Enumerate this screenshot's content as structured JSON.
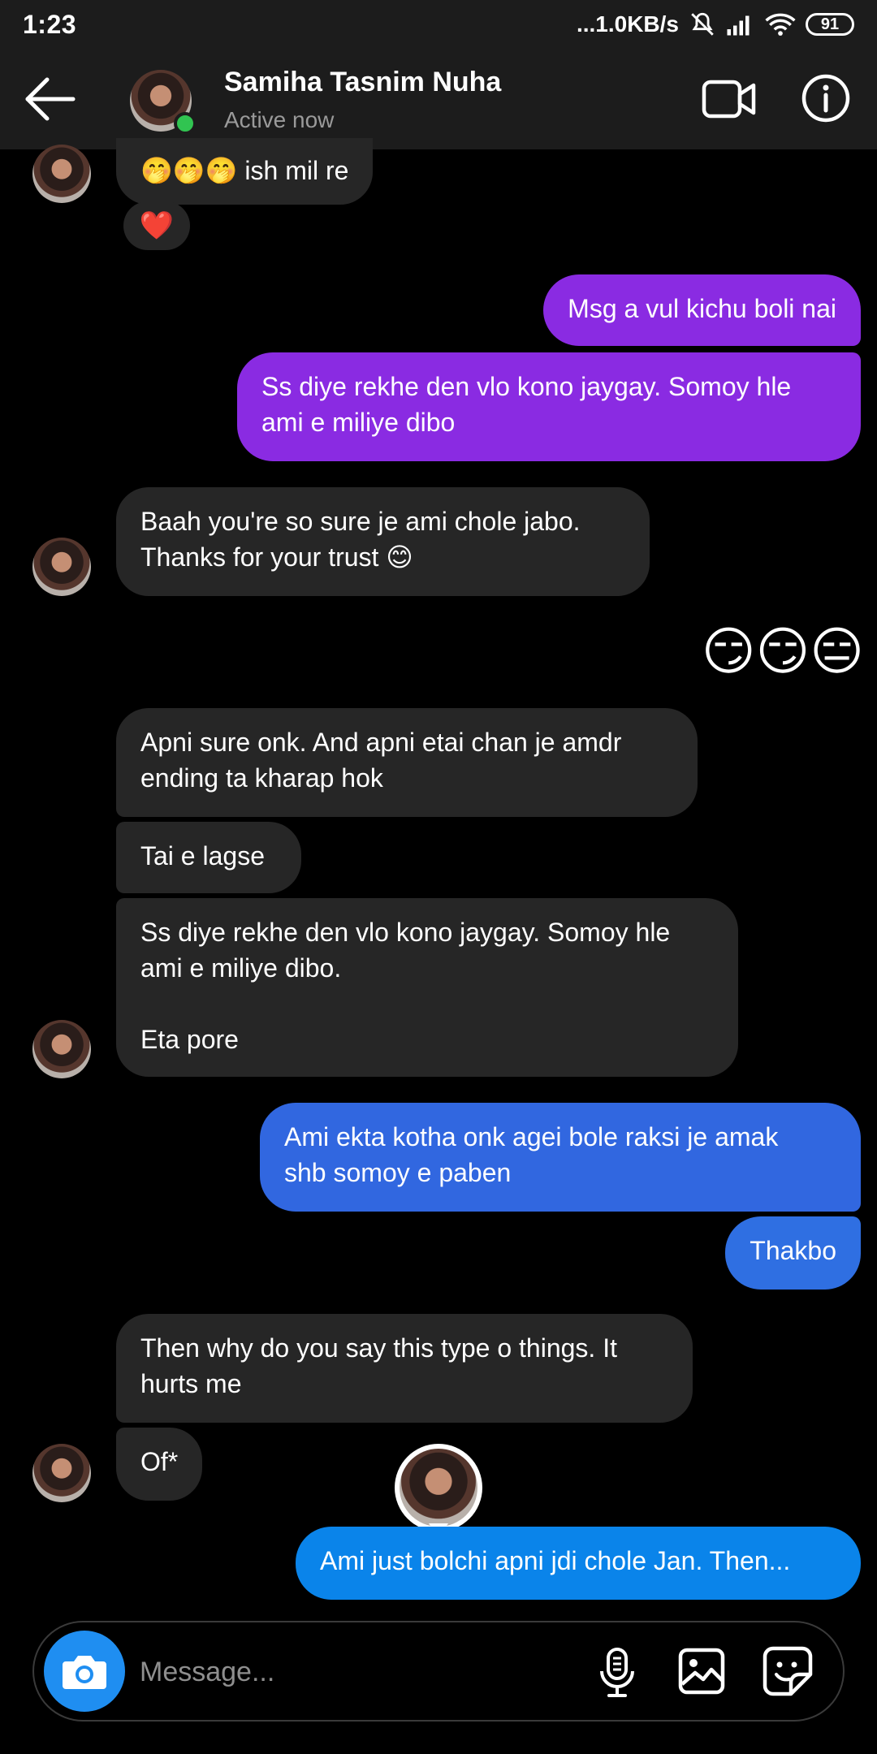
{
  "status_bar": {
    "time": "1:23",
    "network_speed": "...1.0KB/s",
    "battery": "91",
    "icons": [
      "mute-icon",
      "signal-icon",
      "wifi-icon",
      "battery-icon"
    ]
  },
  "header": {
    "contact_name": "Samiha Tasnim Nuha",
    "contact_status": "Active now",
    "online_color": "#31c451"
  },
  "messages": [
    {
      "from": "them",
      "text": "🤭🤭🤭 ish mil re",
      "reaction": "❤️"
    },
    {
      "from": "me",
      "text": "Msg a vul kichu boli nai"
    },
    {
      "from": "me",
      "text": "Ss diye rekhe den vlo kono jaygay. Somoy hle\nami e miliye dibo"
    },
    {
      "from": "them",
      "text": "Baah you're so sure je ami chole jabo.\nThanks for your trust 😊"
    },
    {
      "from": "me",
      "text": "😏😏😑"
    },
    {
      "from": "them",
      "text": "Apni sure onk. And apni etai chan je amdr\nending ta kharap hok"
    },
    {
      "from": "them",
      "text": "Tai e lagse"
    },
    {
      "from": "them",
      "text": "Ss diye rekhe den vlo kono jaygay. Somoy hle\nami e miliye dibo.\n\nEta pore"
    },
    {
      "from": "me",
      "text": "Ami ekta kotha onk agei bole raksi je amak\nshb somoy e paben"
    },
    {
      "from": "me",
      "text": "Thakbo"
    },
    {
      "from": "them",
      "text": "Then why do you say this type o things. It\nhurts me"
    },
    {
      "from": "them",
      "text": "Of*"
    },
    {
      "from": "me",
      "text": "Ami just bolchi apni jdi chole Jan. Then..."
    }
  ],
  "composer": {
    "placeholder": "Message..."
  },
  "colors": {
    "bubble_incoming": "#262626",
    "bubble_outgoing_purple": "#8a2be2",
    "bubble_outgoing_blue": "#3167e0",
    "bubble_outgoing_cyan": "#0a84ea",
    "camera_button": "#1f8ef1",
    "reaction_heart": "#e0223a"
  }
}
